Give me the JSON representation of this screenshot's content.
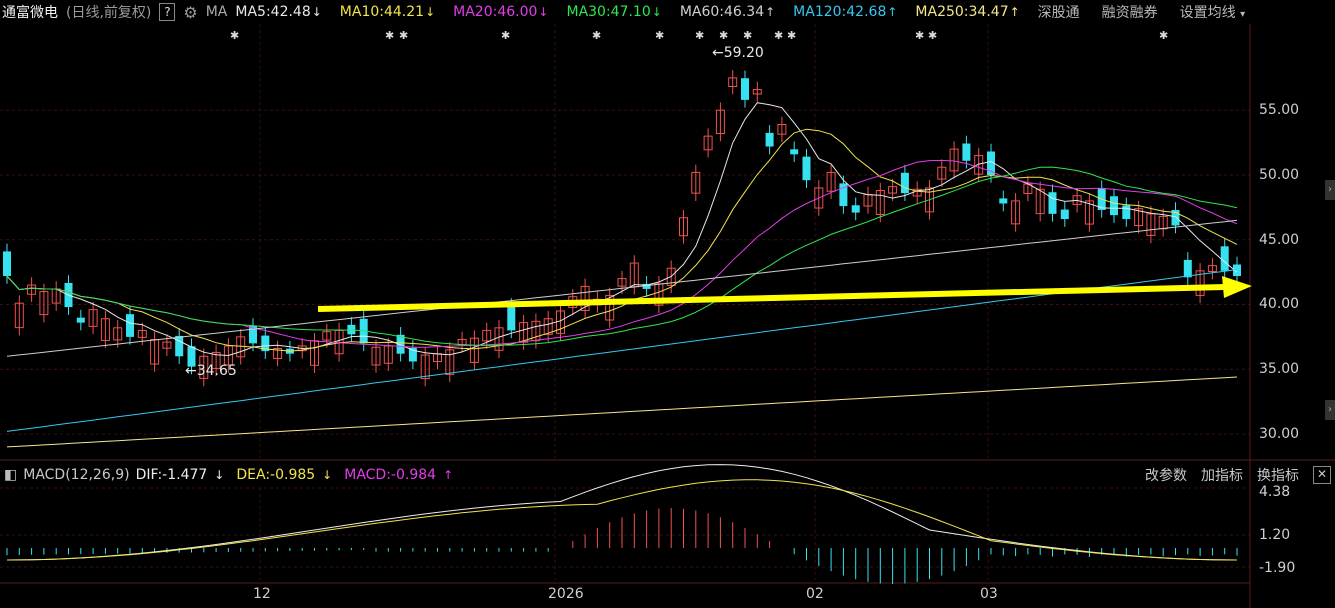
{
  "header": {
    "stock_name": "通富微电",
    "mode": "(日线,前复权)",
    "help": "?",
    "ma_prefix": "MA",
    "ma_items": [
      {
        "label": "MA5:42.48",
        "arrow": "↓",
        "color": "#e8e8e8"
      },
      {
        "label": "MA10:44.21",
        "arrow": "↓",
        "color": "#f2e44a"
      },
      {
        "label": "MA20:46.00",
        "arrow": "↓",
        "color": "#e23ee8"
      },
      {
        "label": "MA30:47.10",
        "arrow": "↓",
        "color": "#2fe64f"
      },
      {
        "label": "MA60:46.34",
        "arrow": "↑",
        "color": "#cfcfcf"
      },
      {
        "label": "MA120:42.68",
        "arrow": "↑",
        "color": "#37c8f0"
      },
      {
        "label": "MA250:34.47",
        "arrow": "↑",
        "color": "#f5e78a"
      }
    ],
    "links": [
      "深股通",
      "融资融券"
    ],
    "settings": "设置均线"
  },
  "price_axis": [
    "55.00",
    "50.00",
    "45.00",
    "40.00",
    "35.00",
    "30.00"
  ],
  "macd_header": {
    "title": "MACD(12,26,9)",
    "dif": "DIF:-1.477",
    "dif_arrow": "↓",
    "dea": "DEA:-0.985",
    "dea_arrow": "↓",
    "macd": "MACD:-0.984",
    "macd_arrow": "↑",
    "tools": [
      "改参数",
      "加指标",
      "换指标"
    ],
    "close": "✕"
  },
  "macd_axis": [
    "4.38",
    "1.20",
    "-1.90"
  ],
  "time_axis": [
    "12",
    "2026",
    "02",
    "03"
  ],
  "annotations": {
    "high": "59.20",
    "low": "34.65"
  },
  "colors": {
    "up": "#f0524f",
    "down": "#37e2f0",
    "arrow": "#ffff00",
    "grid": "#3a1010"
  }
}
